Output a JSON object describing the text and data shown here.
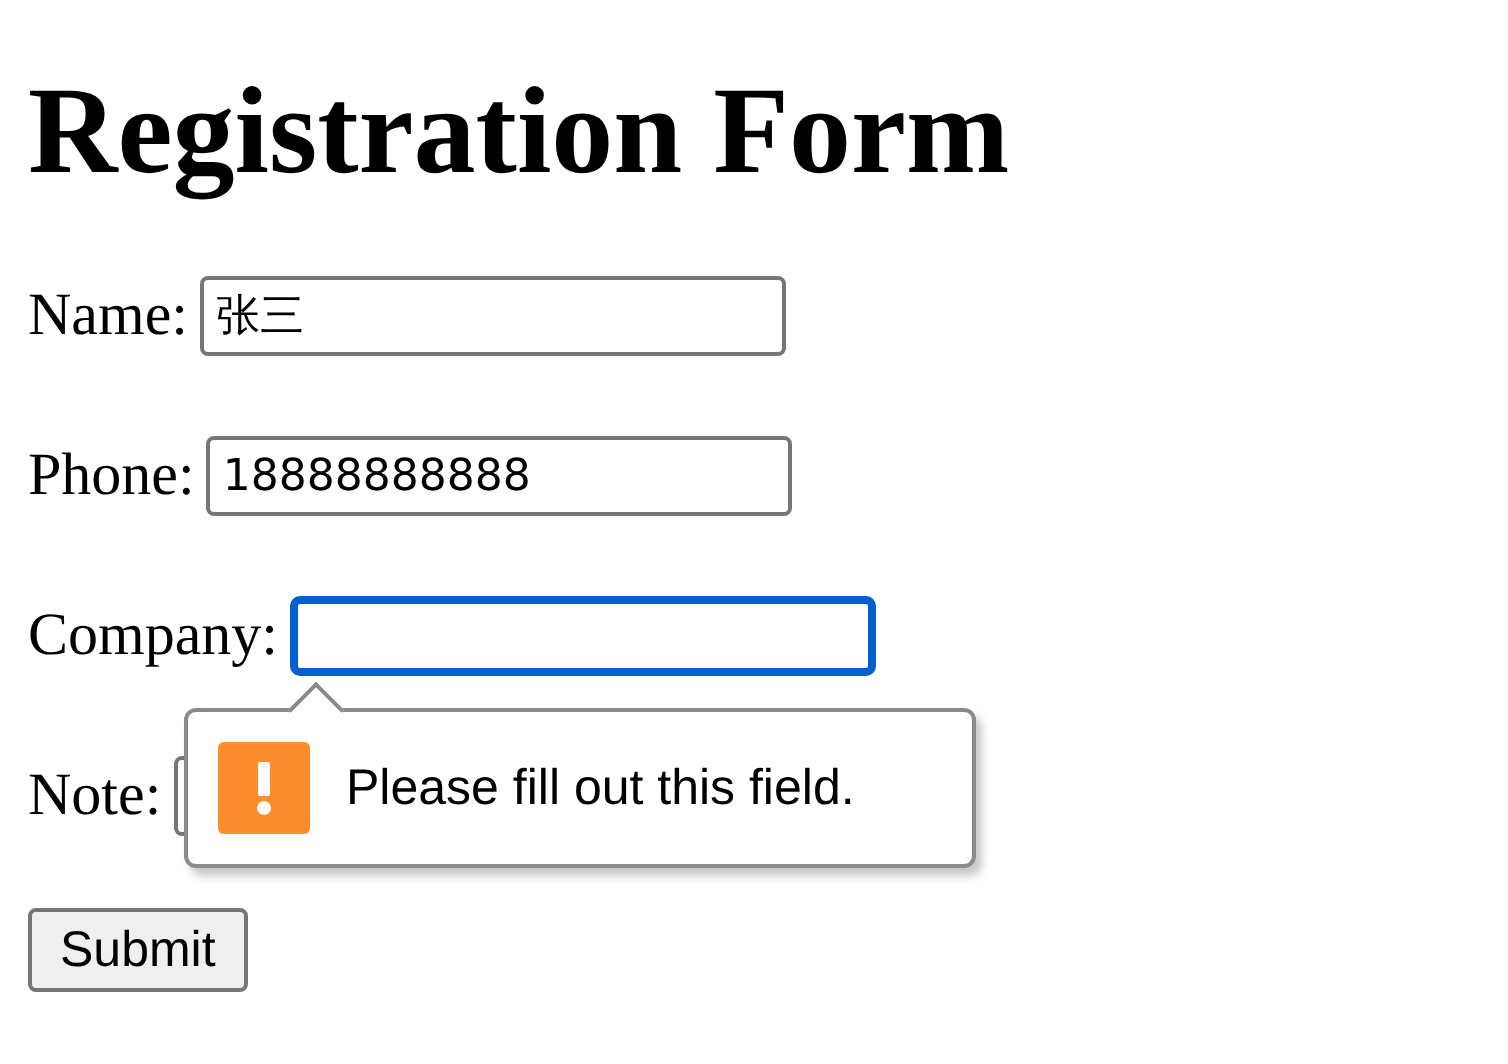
{
  "title": "Registration Form",
  "fields": [
    {
      "label": "Name:",
      "value": "张三",
      "focused": false
    },
    {
      "label": "Phone:",
      "value": "18888888888",
      "focused": false
    },
    {
      "label": "Company:",
      "focused": true,
      "validation_message": "Please fill out this field."
    },
    {
      "label": "Note:",
      "focused": false
    }
  ],
  "submit_button": "Submit"
}
